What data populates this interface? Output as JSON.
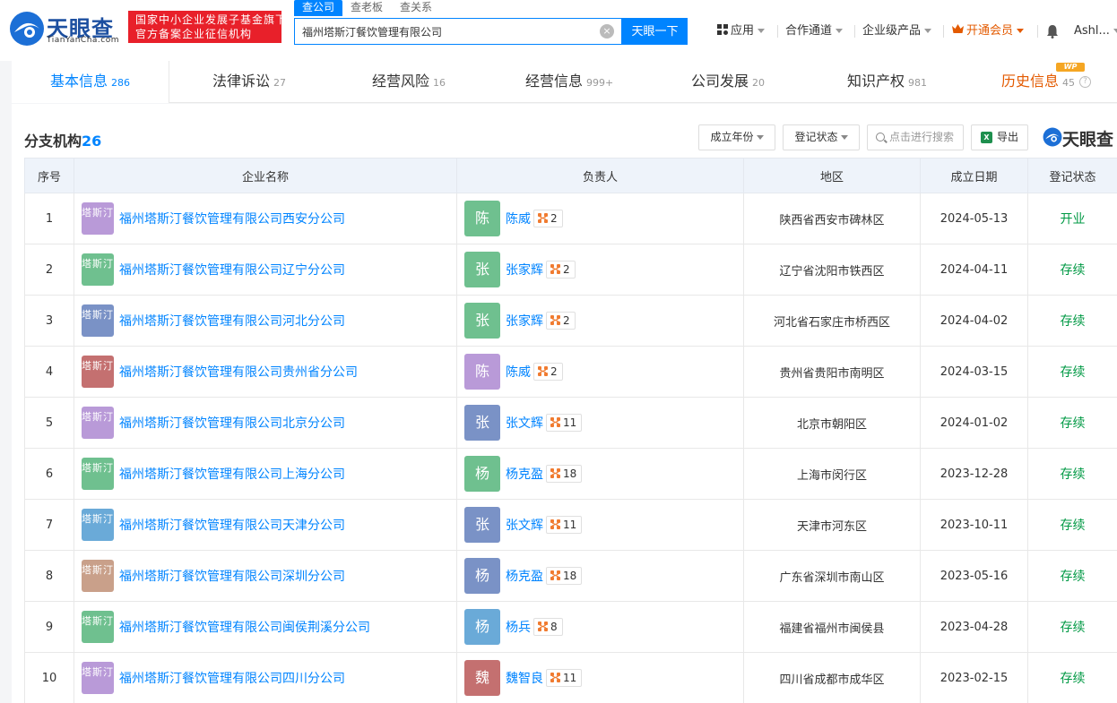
{
  "header": {
    "logo_text": "天眼查",
    "logo_sub": "TianYanCha.com",
    "promo_line1": "国家中小企业发展子基金旗下",
    "promo_line2": "官方备案企业征信机构",
    "search_tabs": [
      "查公司",
      "查老板",
      "查关系"
    ],
    "search_value": "福州塔斯汀餐饮管理有限公司",
    "search_button": "天眼一下",
    "nav": [
      "应用",
      "合作通道",
      "企业级产品",
      "开通会员"
    ],
    "user": "Ashl..."
  },
  "tabs": [
    {
      "label": "基本信息",
      "count": "286"
    },
    {
      "label": "法律诉讼",
      "count": "27"
    },
    {
      "label": "经营风险",
      "count": "16"
    },
    {
      "label": "经营信息",
      "count": "999+"
    },
    {
      "label": "公司发展",
      "count": "20"
    },
    {
      "label": "知识产权",
      "count": "981"
    },
    {
      "label": "历史信息",
      "count": "45"
    }
  ],
  "wp_badge": "WP",
  "section": {
    "title": "分支机构",
    "count": "26",
    "filters": [
      "成立年份",
      "登记状态"
    ],
    "search_placeholder": "点击进行搜索",
    "export_label": "导出",
    "watermark": "天眼查"
  },
  "table": {
    "columns": [
      "序号",
      "企业名称",
      "负责人",
      "地区",
      "成立日期",
      "登记状态"
    ],
    "rows": [
      {
        "no": "1",
        "logo": "塔斯汀",
        "logo_color": "#b99ad8",
        "name": "福州塔斯汀餐饮管理有限公司西安分公司",
        "person": "陈威",
        "avatar": "陈",
        "avatar_color": "#6fc08f",
        "rel": "2",
        "region": "陕西省西安市碑林区",
        "date": "2024-05-13",
        "status": "开业"
      },
      {
        "no": "2",
        "logo": "塔斯汀",
        "logo_color": "#6fc08f",
        "name": "福州塔斯汀餐饮管理有限公司辽宁分公司",
        "person": "张家辉",
        "avatar": "张",
        "avatar_color": "#6fc08f",
        "rel": "2",
        "region": "辽宁省沈阳市铁西区",
        "date": "2024-04-11",
        "status": "存续"
      },
      {
        "no": "3",
        "logo": "塔斯汀",
        "logo_color": "#7a92c6",
        "name": "福州塔斯汀餐饮管理有限公司河北分公司",
        "person": "张家辉",
        "avatar": "张",
        "avatar_color": "#6fc08f",
        "rel": "2",
        "region": "河北省石家庄市桥西区",
        "date": "2024-04-02",
        "status": "存续"
      },
      {
        "no": "4",
        "logo": "塔斯汀",
        "logo_color": "#c47070",
        "name": "福州塔斯汀餐饮管理有限公司贵州省分公司",
        "person": "陈威",
        "avatar": "陈",
        "avatar_color": "#b99ad8",
        "rel": "2",
        "region": "贵州省贵阳市南明区",
        "date": "2024-03-15",
        "status": "存续"
      },
      {
        "no": "5",
        "logo": "塔斯汀",
        "logo_color": "#b99ad8",
        "name": "福州塔斯汀餐饮管理有限公司北京分公司",
        "person": "张文辉",
        "avatar": "张",
        "avatar_color": "#7a92c6",
        "rel": "11",
        "region": "北京市朝阳区",
        "date": "2024-01-02",
        "status": "存续"
      },
      {
        "no": "6",
        "logo": "塔斯汀",
        "logo_color": "#6fc08f",
        "name": "福州塔斯汀餐饮管理有限公司上海分公司",
        "person": "杨克盈",
        "avatar": "杨",
        "avatar_color": "#6fc08f",
        "rel": "18",
        "region": "上海市闵行区",
        "date": "2023-12-28",
        "status": "存续"
      },
      {
        "no": "7",
        "logo": "塔斯汀",
        "logo_color": "#6aaad8",
        "name": "福州塔斯汀餐饮管理有限公司天津分公司",
        "person": "张文辉",
        "avatar": "张",
        "avatar_color": "#7a92c6",
        "rel": "11",
        "region": "天津市河东区",
        "date": "2023-10-11",
        "status": "存续"
      },
      {
        "no": "8",
        "logo": "塔斯汀",
        "logo_color": "#c9a08a",
        "name": "福州塔斯汀餐饮管理有限公司深圳分公司",
        "person": "杨克盈",
        "avatar": "杨",
        "avatar_color": "#7a92c6",
        "rel": "18",
        "region": "广东省深圳市南山区",
        "date": "2023-05-16",
        "status": "存续"
      },
      {
        "no": "9",
        "logo": "塔斯汀",
        "logo_color": "#6fc08f",
        "name": "福州塔斯汀餐饮管理有限公司闽侯荆溪分公司",
        "person": "杨兵",
        "avatar": "杨",
        "avatar_color": "#6aaad8",
        "rel": "8",
        "region": "福建省福州市闽侯县",
        "date": "2023-04-28",
        "status": "存续"
      },
      {
        "no": "10",
        "logo": "塔斯汀",
        "logo_color": "#b99ad8",
        "name": "福州塔斯汀餐饮管理有限公司四川分公司",
        "person": "魏智良",
        "avatar": "魏",
        "avatar_color": "#c47070",
        "rel": "11",
        "region": "四川省成都市成华区",
        "date": "2023-02-15",
        "status": "存续"
      }
    ]
  }
}
